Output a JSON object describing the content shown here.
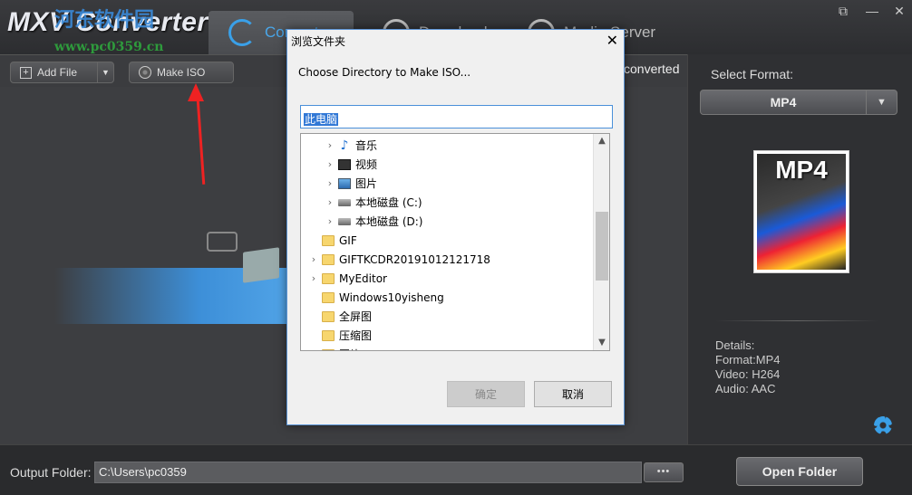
{
  "app": {
    "title": "MXV Converter",
    "watermark": "河东软件园",
    "watermark_url": "www.pc0359.cn"
  },
  "tabs": [
    {
      "label": "Convert",
      "icon": "refresh-icon"
    },
    {
      "label": "Download",
      "icon": "download-icon"
    },
    {
      "label": "Media Server",
      "icon": "media-server-icon"
    }
  ],
  "window_controls": {
    "restore": "⧉",
    "minimize": "—",
    "close": "✕"
  },
  "toolbar": {
    "add_file_label": "Add File",
    "add_file_dropdown": "▼",
    "make_iso_label": "Make ISO"
  },
  "main": {
    "converted_label": "converted"
  },
  "right_panel": {
    "select_format_label": "Select Format:",
    "format_value": "MP4",
    "format_arrow": "▼",
    "thumb_text": "MP4",
    "details": [
      "Details:",
      "Format:MP4",
      "Video: H264",
      "Audio: AAC"
    ]
  },
  "bottom": {
    "output_label": "Output Folder:",
    "output_path": "C:\\Users\\pc0359",
    "browse_label": "•••",
    "open_folder_label": "Open Folder"
  },
  "dialog": {
    "title": "浏览文件夹",
    "close": "✕",
    "caption": "Choose Directory to Make ISO...",
    "input_value": "此电脑",
    "tree": [
      {
        "label": "音乐",
        "icon": "music",
        "indent": 26,
        "expander": "›"
      },
      {
        "label": "视频",
        "icon": "video",
        "indent": 26,
        "expander": "›"
      },
      {
        "label": "图片",
        "icon": "picture",
        "indent": 26,
        "expander": "›"
      },
      {
        "label": "本地磁盘 (C:)",
        "icon": "drive",
        "indent": 26,
        "expander": "›"
      },
      {
        "label": "本地磁盘 (D:)",
        "icon": "drive",
        "indent": 26,
        "expander": "›"
      },
      {
        "label": "GIF",
        "icon": "folder",
        "indent": 8,
        "expander": ""
      },
      {
        "label": "GIFTKCDR20191012121718",
        "icon": "folder",
        "indent": 8,
        "expander": "›"
      },
      {
        "label": "MyEditor",
        "icon": "folder",
        "indent": 8,
        "expander": "›"
      },
      {
        "label": "Windows10yisheng",
        "icon": "folder",
        "indent": 8,
        "expander": ""
      },
      {
        "label": "全屏图",
        "icon": "folder",
        "indent": 8,
        "expander": ""
      },
      {
        "label": "压缩图",
        "icon": "folder",
        "indent": 8,
        "expander": ""
      },
      {
        "label": "图片",
        "icon": "folder",
        "indent": 8,
        "expander": "›"
      }
    ],
    "scroll_up": "▲",
    "scroll_down": "▼",
    "ok_label": "确定",
    "cancel_label": "取消"
  }
}
